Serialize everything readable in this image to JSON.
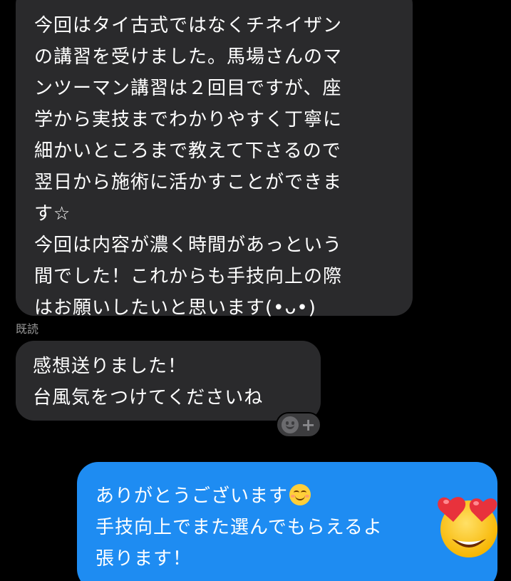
{
  "messages": {
    "incoming_1": {
      "lines": [
        "今回はタイ古式ではなくチネイザン",
        "の講習を受けました。馬場さんのマ",
        "ンツーマン講習は２回目ですが、座",
        "学から実技までわかりやすく丁寧に",
        "細かいところまで教えて下さるので",
        "翌日から施術に活かすことができま",
        "す☆",
        "今回は内容が濃く時間があっという",
        "間でした！これからも手技向上の際",
        "はお願いしたいと思います(•ᴗ•)"
      ]
    },
    "read_receipt": "既読",
    "incoming_2": {
      "lines": [
        "感想送りました！",
        "台風気をつけてくださいね"
      ]
    },
    "outgoing_1": {
      "lines": [
        "ありがとうございます",
        "手技向上でまた選んでもらえるよ",
        "張ります！"
      ],
      "inline_emoji": "smiling-face-icon"
    }
  },
  "icons": {
    "reaction": "add-reaction-icon",
    "sticker": "heart-eyes-emoji-icon"
  },
  "colors": {
    "background": "#000000",
    "incoming_bubble": "#2a2a2c",
    "outgoing_bubble": "#1e8cf2",
    "read_receipt": "#9a9a9a"
  }
}
